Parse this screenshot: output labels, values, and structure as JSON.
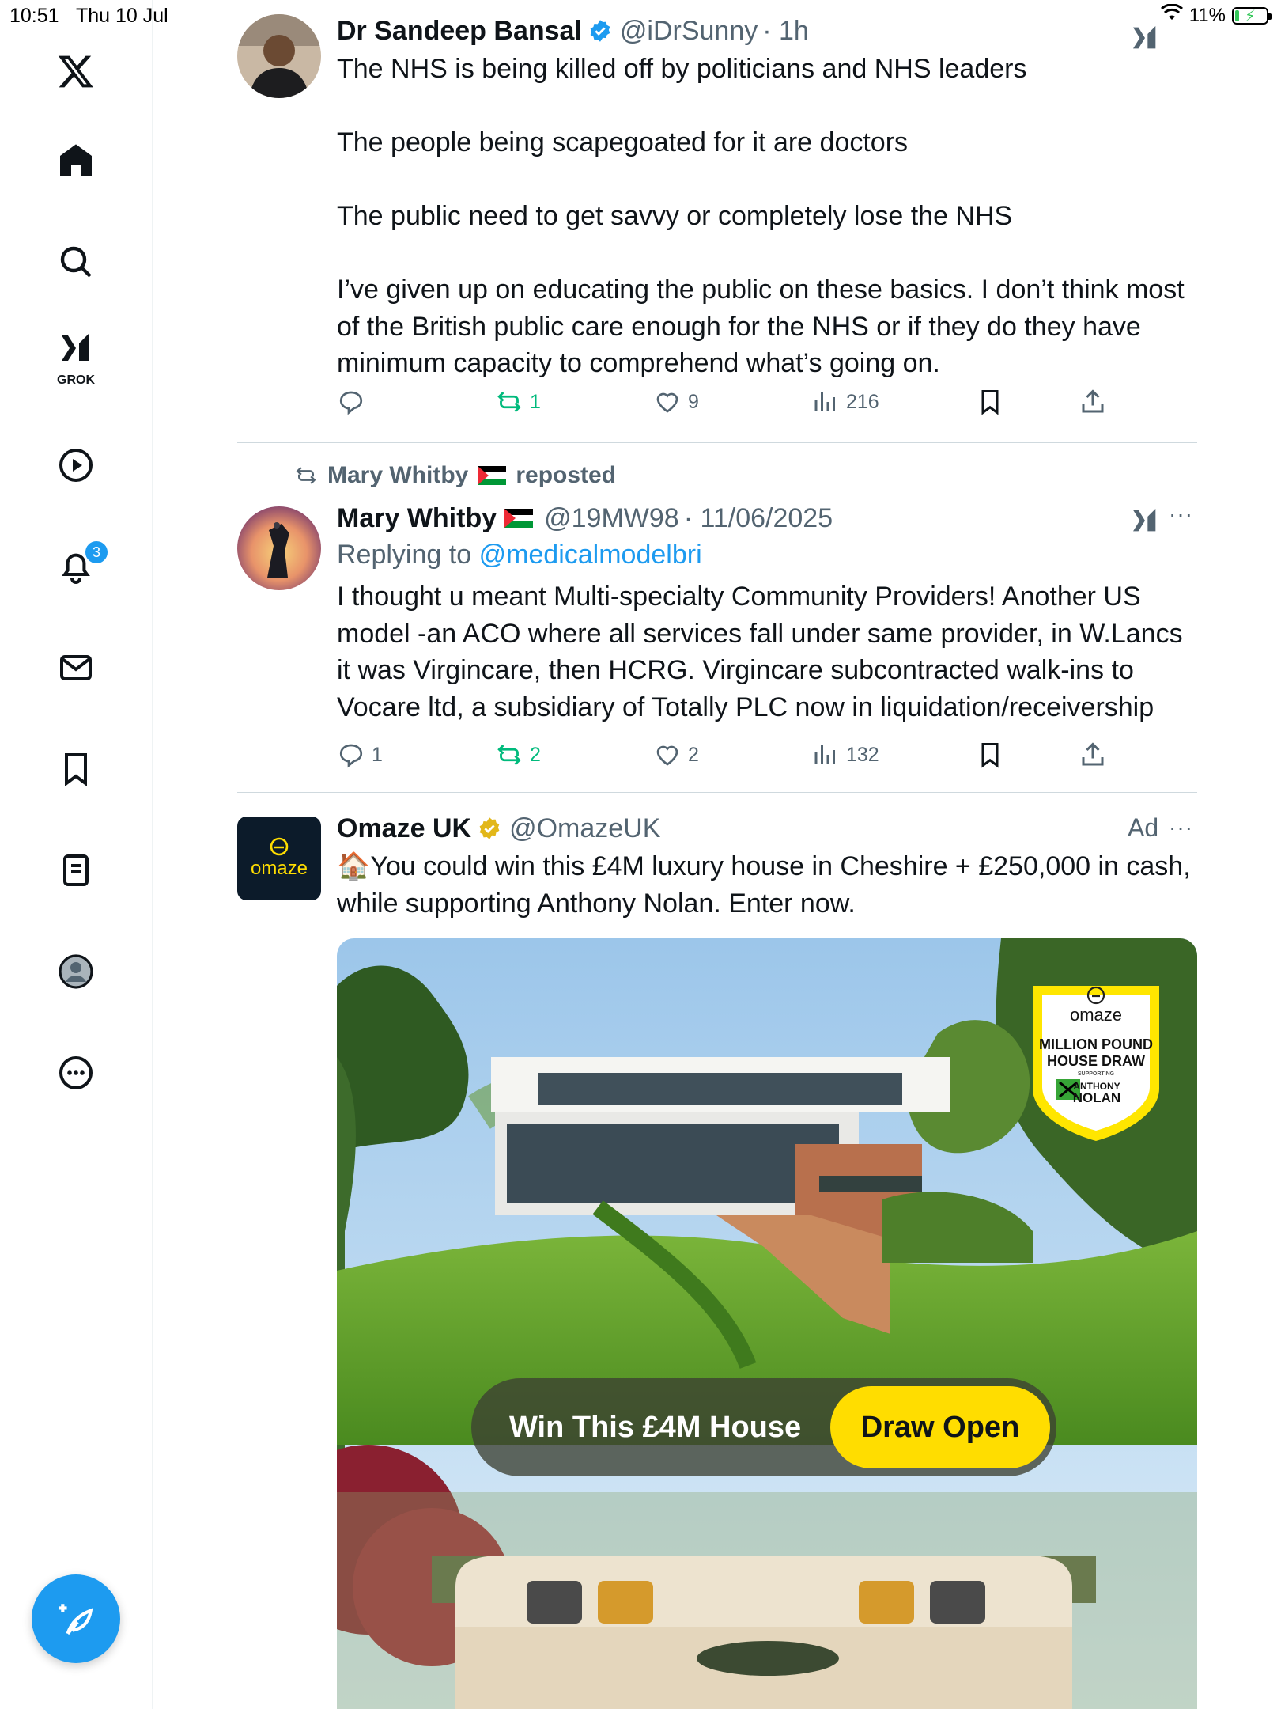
{
  "status": {
    "time": "10:51",
    "date": "Thu 10 Jul",
    "battery": "11%",
    "battery_level": 0.11
  },
  "sidebar": {
    "grok_label": "GROK",
    "notifications_count": "3",
    "items": [
      "x-logo",
      "home",
      "explore",
      "grok",
      "video",
      "notifications",
      "messages",
      "bookmarks",
      "lists",
      "profile",
      "more"
    ]
  },
  "tweets": [
    {
      "name": "Dr Sandeep Bansal",
      "handle": "@iDrSunny",
      "time": "· 1h",
      "text": "The NHS is being killed off by politicians and NHS leaders\n\nThe people being scapegoated for it are doctors\n\nThe public need to get savvy or completely lose the NHS\n\nI’ve given up on educating the public on these basics. I don’t think most of the British public care enough for the NHS or if they do they have minimum capacity to comprehend what’s going on.",
      "replies": "",
      "reposts": "1",
      "likes": "9",
      "views": "216"
    },
    {
      "repost_by": "Mary Whitby",
      "repost_label": "reposted",
      "name": "Mary Whitby",
      "handle": "@19MW98",
      "time": "· 11/06/2025",
      "replying_prefix": "Replying to",
      "replying_to": "@medicalmodelbri",
      "text": "I thought u meant Multi-specialty Community Providers! Another US model -an ACO where all services fall under same provider, in W.Lancs it was Virgincare, then HCRG. Virgincare subcontracted walk-ins to Vocare ltd, a subsidiary of Totally PLC now in liquidation/receivership",
      "replies": "1",
      "reposts": "2",
      "likes": "2",
      "views": "132"
    },
    {
      "name": "Omaze UK",
      "handle": "@OmazeUK",
      "ad_label": "Ad",
      "avatar_text": "omaze",
      "text": "🏠You could win this £4M luxury house in Cheshire + £250,000 in cash, while supporting Anthony Nolan. Enter now.",
      "image": {
        "pill_text": "Win This £4M House",
        "button": "Draw Open",
        "badge_brand": "omaze",
        "badge_line1": "MILLION POUND",
        "badge_line2": "HOUSE DRAW",
        "badge_supporting": "SUPPORTING",
        "badge_partner1": "ANTHONY",
        "badge_partner2": "NOLAN"
      }
    }
  ]
}
